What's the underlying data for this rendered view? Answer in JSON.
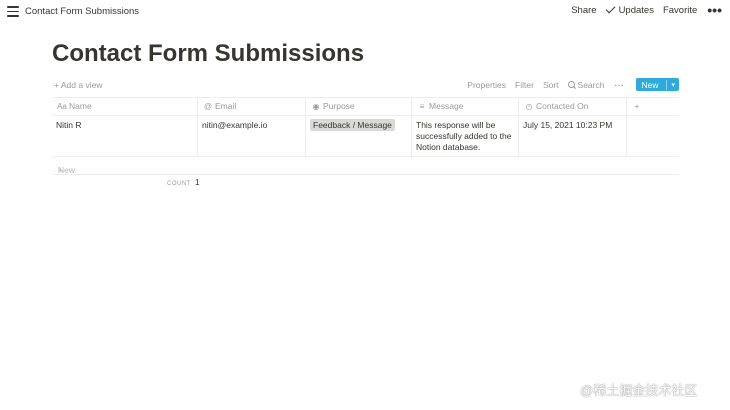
{
  "topbar": {
    "breadcrumb": "Contact Form Submissions",
    "share": "Share",
    "updates": "Updates",
    "favorite": "Favorite"
  },
  "page": {
    "title": "Contact Form Submissions"
  },
  "viewbar": {
    "add_view": "Add a view",
    "properties": "Properties",
    "filter": "Filter",
    "sort": "Sort",
    "search": "Search",
    "new_button": "New"
  },
  "table": {
    "columns": [
      {
        "label": "Name",
        "icon": "text-type-icon"
      },
      {
        "label": "Email",
        "icon": "at-icon"
      },
      {
        "label": "Purpose",
        "icon": "select-icon"
      },
      {
        "label": "Message",
        "icon": "lines-icon"
      },
      {
        "label": "Contacted On",
        "icon": "clock-icon"
      }
    ],
    "rows": [
      {
        "name": "Nitin R",
        "email": "nitin@example.io",
        "purpose": "Feedback / Message",
        "message": "This response will be successfully added to the Notion database.",
        "contacted_on": "July 15, 2021 10:23 PM"
      }
    ],
    "new_row": "New",
    "count_label": "COUNT",
    "count_value": "1"
  },
  "colors": {
    "accent": "#2eaadc",
    "text": "#37352f",
    "muted": "#9b9a97",
    "tag_bg": "#d9d9d7"
  },
  "watermark": "@稀土掘金技术社区"
}
